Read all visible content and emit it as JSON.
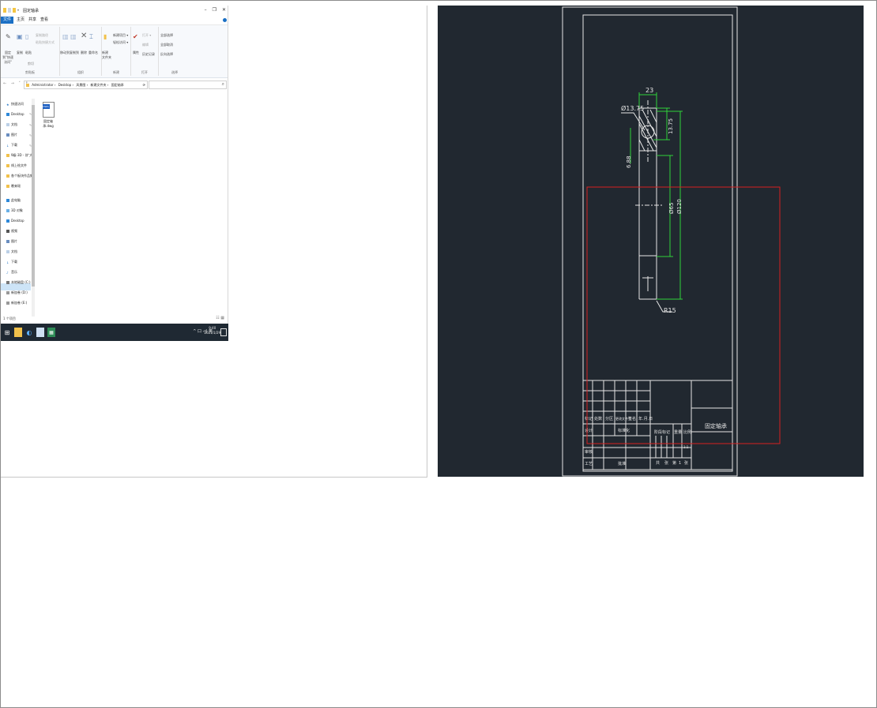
{
  "explorer": {
    "window_title": "固定轴承",
    "window_buttons": {
      "minimize": "–",
      "maximize": "❐",
      "close": "✕"
    },
    "tabs": [
      "文件",
      "主页",
      "共享",
      "查看"
    ],
    "ribbon": {
      "clipboard": {
        "pin_label": "固定到\"快速访问\"",
        "copy": "复制",
        "paste": "粘贴",
        "copy_path": "复制路径",
        "paste_shortcut": "粘贴快捷方式",
        "cut": "剪切",
        "group": "剪贴板"
      },
      "organize": {
        "move_to": "移动到",
        "copy_to": "复制到",
        "delete": "删除",
        "rename": "重命名",
        "group": "组织"
      },
      "new": {
        "new_folder": "新建\n文件夹",
        "new_item": "新建项目 ▾",
        "easy_access": "轻松访问 ▾",
        "group": "新建"
      },
      "open": {
        "properties": "属性",
        "open": "打开 ▾",
        "edit": "编辑",
        "history": "历史记录",
        "group": "打开"
      },
      "select": {
        "select_all": "全部选择",
        "select_none": "全部取消",
        "invert": "反向选择",
        "group": "选择"
      }
    },
    "address_path": [
      "Administrator",
      "Desktop",
      "风景图",
      "新建文件夹",
      "固定轴承"
    ],
    "nav_items": [
      "快速访问",
      "Desktop",
      "文档",
      "图片",
      "下载",
      "9级-3D - (扩大)",
      "线上绘文件",
      "各个板块作品集",
      "晚来瑶",
      "此电脑",
      "3D 对象",
      "Desktop",
      "视频",
      "图片",
      "文档",
      "下载",
      "音乐",
      "本地磁盘 (C:)",
      "新加卷 (D:)",
      "新加卷 (E:)"
    ],
    "file": {
      "badge": "DWG",
      "name": "固定轴承.dwg"
    },
    "status_count": "1 个项目",
    "taskbar": {
      "tray_text": "^ 口 ◁) 英",
      "time": "9:40",
      "date": "2021/1/29"
    }
  },
  "cad": {
    "dims": {
      "d1": "23",
      "d2": "Ø13.75",
      "d3": "13.75",
      "d4": "6.88",
      "d5": "Ø65",
      "d6": "Ø120",
      "d7": "R15"
    },
    "title_block": {
      "name": "固定轴承",
      "rows": [
        "标记",
        "处数",
        "分区",
        "更改文件号",
        "签名",
        "年.月.日"
      ],
      "left": [
        "设计",
        "审核",
        "工艺"
      ],
      "mid": [
        "标准化",
        "批准"
      ],
      "stage": [
        "阶段标记",
        "重量",
        "比例"
      ],
      "sheet": [
        "共",
        "张",
        "第",
        "1",
        "张"
      ],
      "scale_value": "1:1"
    }
  }
}
